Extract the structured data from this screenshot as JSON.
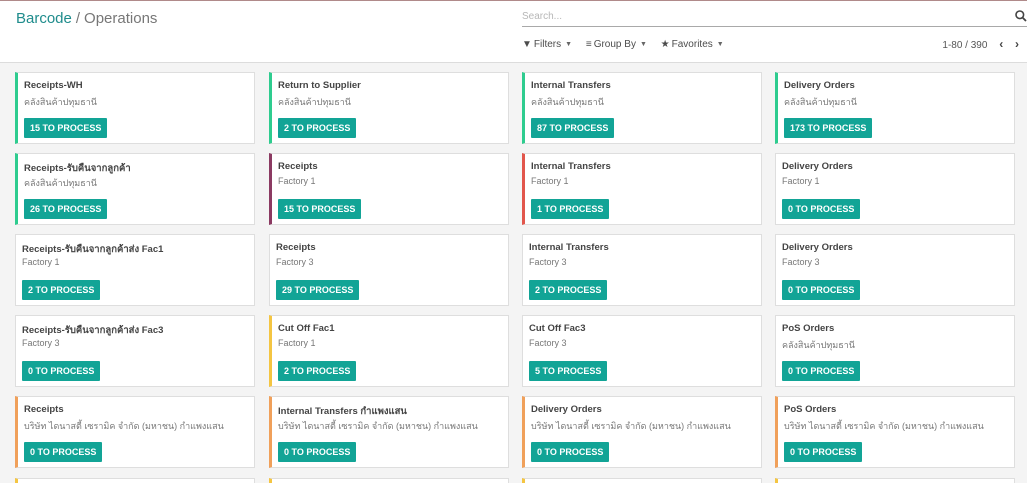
{
  "breadcrumb": {
    "app": "Barcode",
    "separator": "/",
    "current": "Operations"
  },
  "search": {
    "placeholder": "Search..."
  },
  "filters": {
    "filters_label": "Filters",
    "groupby_label": "Group By",
    "favorites_label": "Favorites"
  },
  "pager": {
    "value": "1-80 / 390"
  },
  "icons": {
    "search": "search-icon",
    "filter": "funnel-icon",
    "groupby": "list-icon",
    "favorites": "star-icon",
    "prev": "chevron-left-icon",
    "next": "chevron-right-icon",
    "dropdown": "caret-down-icon"
  },
  "colors": {
    "accent": "#1f8c8c",
    "button": "#12a496",
    "green": "#2ecc8f",
    "purple": "#8b3a62",
    "red": "#e2564c",
    "yellow": "#f4c542",
    "orange": "#f0a05a"
  },
  "cards": [
    {
      "title": "Receipts-WH",
      "subtitle": "คลังสินค้าปทุมธานี",
      "count": "15 TO PROCESS",
      "color": "#2ecc8f"
    },
    {
      "title": "Return to Supplier",
      "subtitle": "คลังสินค้าปทุมธานี",
      "count": "2 TO PROCESS",
      "color": "#2ecc8f"
    },
    {
      "title": "Internal Transfers",
      "subtitle": "คลังสินค้าปทุมธานี",
      "count": "87 TO PROCESS",
      "color": "#2ecc8f"
    },
    {
      "title": "Delivery Orders",
      "subtitle": "คลังสินค้าปทุมธานี",
      "count": "173 TO PROCESS",
      "color": "#2ecc8f"
    },
    {
      "title": "Receipts-รับคืนจากลูกค้า",
      "subtitle": "คลังสินค้าปทุมธานี",
      "count": "26 TO PROCESS",
      "color": "#2ecc8f"
    },
    {
      "title": "Receipts",
      "subtitle": "Factory 1",
      "count": "15 TO PROCESS",
      "color": "#8b3a62"
    },
    {
      "title": "Internal Transfers",
      "subtitle": "Factory 1",
      "count": "1 TO PROCESS",
      "color": "#e2564c"
    },
    {
      "title": "Delivery Orders",
      "subtitle": "Factory 1",
      "count": "0 TO PROCESS",
      "color": ""
    },
    {
      "title": "Receipts-รับคืนจากลูกค้าส่ง Fac1",
      "subtitle": "Factory 1",
      "count": "2 TO PROCESS",
      "color": ""
    },
    {
      "title": "Receipts",
      "subtitle": "Factory 3",
      "count": "29 TO PROCESS",
      "color": ""
    },
    {
      "title": "Internal Transfers",
      "subtitle": "Factory 3",
      "count": "2 TO PROCESS",
      "color": ""
    },
    {
      "title": "Delivery Orders",
      "subtitle": "Factory 3",
      "count": "0 TO PROCESS",
      "color": ""
    },
    {
      "title": "Receipts-รับคืนจากลูกค้าส่ง Fac3",
      "subtitle": "Factory 3",
      "count": "0 TO PROCESS",
      "color": ""
    },
    {
      "title": "Cut Off Fac1",
      "subtitle": "Factory 1",
      "count": "2 TO PROCESS",
      "color": "#f4c542"
    },
    {
      "title": "Cut Off Fac3",
      "subtitle": "Factory 3",
      "count": "5 TO PROCESS",
      "color": ""
    },
    {
      "title": "PoS Orders",
      "subtitle": "คลังสินค้าปทุมธานี",
      "count": "0 TO PROCESS",
      "color": ""
    },
    {
      "title": "Receipts",
      "subtitle": "บริษัท ไดนาสตี้ เซรามิค จำกัด (มหาชน) กำแพงแสน",
      "count": "0 TO PROCESS",
      "color": "#f0a05a"
    },
    {
      "title": "Internal Transfers กำแพงแสน",
      "subtitle": "บริษัท ไดนาสตี้ เซรามิค จำกัด (มหาชน) กำแพงแสน",
      "count": "0 TO PROCESS",
      "color": "#f0a05a"
    },
    {
      "title": "Delivery Orders",
      "subtitle": "บริษัท ไดนาสตี้ เซรามิค จำกัด (มหาชน) กำแพงแสน",
      "count": "0 TO PROCESS",
      "color": "#f0a05a"
    },
    {
      "title": "PoS Orders",
      "subtitle": "บริษัท ไดนาสตี้ เซรามิค จำกัด (มหาชน) กำแพงแสน",
      "count": "0 TO PROCESS",
      "color": "#f0a05a"
    }
  ],
  "peek_colors": [
    "#f4c542",
    "#f4c542",
    "#f4c542",
    "#f4c542"
  ]
}
